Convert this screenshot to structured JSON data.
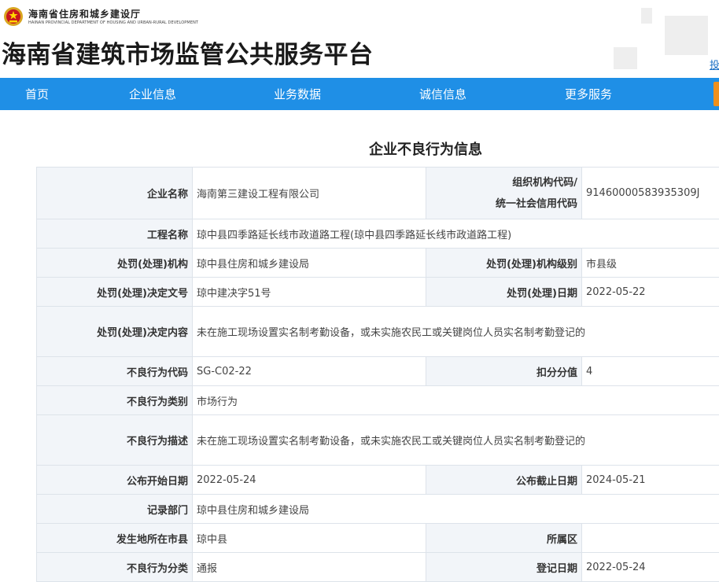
{
  "header": {
    "department_name": "海南省住房和城乡建设厅",
    "department_name_en": "HAINAN PROVINCIAL DEPARTMENT OF HOUSING AND URBAN-RURAL DEVELOPMENT",
    "platform_title": "海南省建筑市场监管公共服务平台",
    "partial_link": "投"
  },
  "nav": {
    "items": [
      "首页",
      "企业信息",
      "业务数据",
      "诚信信息",
      "更多服务"
    ],
    "accent_color": "#f0901c",
    "bar_color": "#1f8fe6"
  },
  "page_title": "企业不良行为信息",
  "labels": {
    "company_name": "企业名称",
    "org_code_line1": "组织机构代码/",
    "org_code_line2": "统一社会信用代码",
    "project_name": "工程名称",
    "punish_agency": "处罚(处理)机构",
    "agency_level": "处罚(处理)机构级别",
    "decision_no": "处罚(处理)决定文号",
    "punish_date": "处罚(处理)日期",
    "decision_content": "处罚(处理)决定内容",
    "behavior_code": "不良行为代码",
    "deduct_points": "扣分分值",
    "behavior_category": "不良行为类别",
    "behavior_desc": "不良行为描述",
    "publish_start": "公布开始日期",
    "publish_end": "公布截止日期",
    "record_dept": "记录部门",
    "city": "发生地所在市县",
    "district": "所属区",
    "behavior_class": "不良行为分类",
    "register_date": "登记日期"
  },
  "values": {
    "company_name": "海南第三建设工程有限公司",
    "org_code": "91460000583935309J",
    "project_name": "琼中县四季路延长线市政道路工程(琼中县四季路延长线市政道路工程)",
    "punish_agency": "琼中县住房和城乡建设局",
    "agency_level": "市县级",
    "decision_no": "琼中建决字51号",
    "punish_date": "2022-05-22",
    "decision_content": "未在施工现场设置实名制考勤设备，或未实施农民工或关键岗位人员实名制考勤登记的",
    "behavior_code": "SG-C02-22",
    "deduct_points": "4",
    "behavior_category": "市场行为",
    "behavior_desc": "未在施工现场设置实名制考勤设备，或未实施农民工或关键岗位人员实名制考勤登记的",
    "publish_start": "2022-05-24",
    "publish_end": "2024-05-21",
    "record_dept": "琼中县住房和城乡建设局",
    "city": "琼中县",
    "district": "",
    "behavior_class": "通报",
    "register_date": "2022-05-24"
  }
}
